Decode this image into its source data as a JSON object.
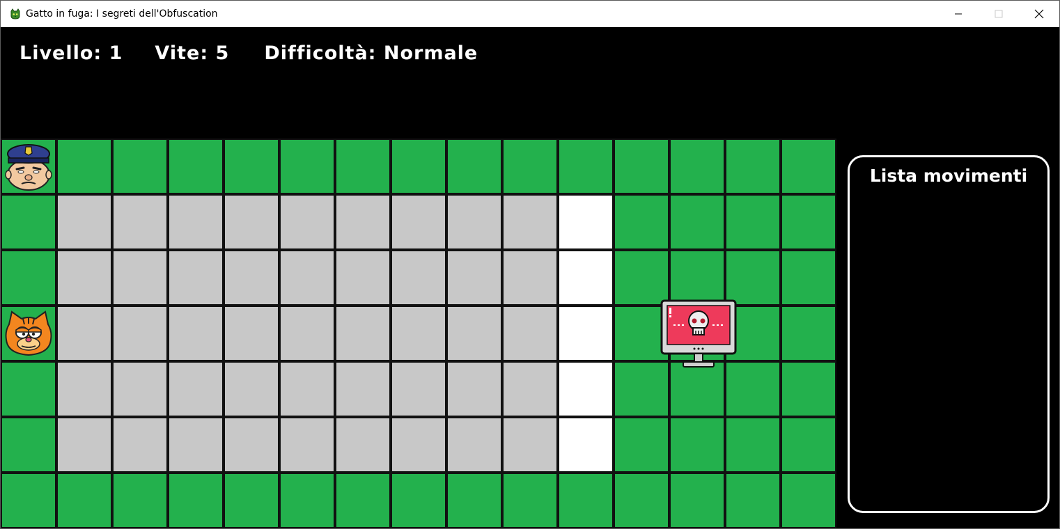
{
  "window": {
    "title": "Gatto in fuga: I segreti dell'Obfuscation",
    "icon": "cat-icon"
  },
  "hud": {
    "level": "Livello: 1",
    "lives": "Vite: 5",
    "difficulty": "Difficoltà: Normale"
  },
  "board": {
    "columns": 15,
    "rows": 7,
    "colors": {
      "grass": "#23b14d",
      "wall": "#c8c8c8",
      "path": "#ffffff",
      "grid": "#111111"
    },
    "layout": [
      "GGGGGGGGGGGGGGG",
      "GWWWWWWWWWPGGGG",
      "GWWWWWWWWWPGGGG",
      "GWWWWWWWWWPGGGG",
      "GWWWWWWWWWPGGGG",
      "GWWWWWWWWWPGGGG",
      "GGGGGGGGGGGGGGG"
    ],
    "entities": [
      {
        "type": "police-officer",
        "row": 0,
        "col": 0
      },
      {
        "type": "cat-garfield",
        "row": 3,
        "col": 0
      },
      {
        "type": "hacked-computer-goal",
        "row": 3,
        "col": 12
      }
    ]
  },
  "panel": {
    "title": "Lista movimenti",
    "moves": []
  }
}
